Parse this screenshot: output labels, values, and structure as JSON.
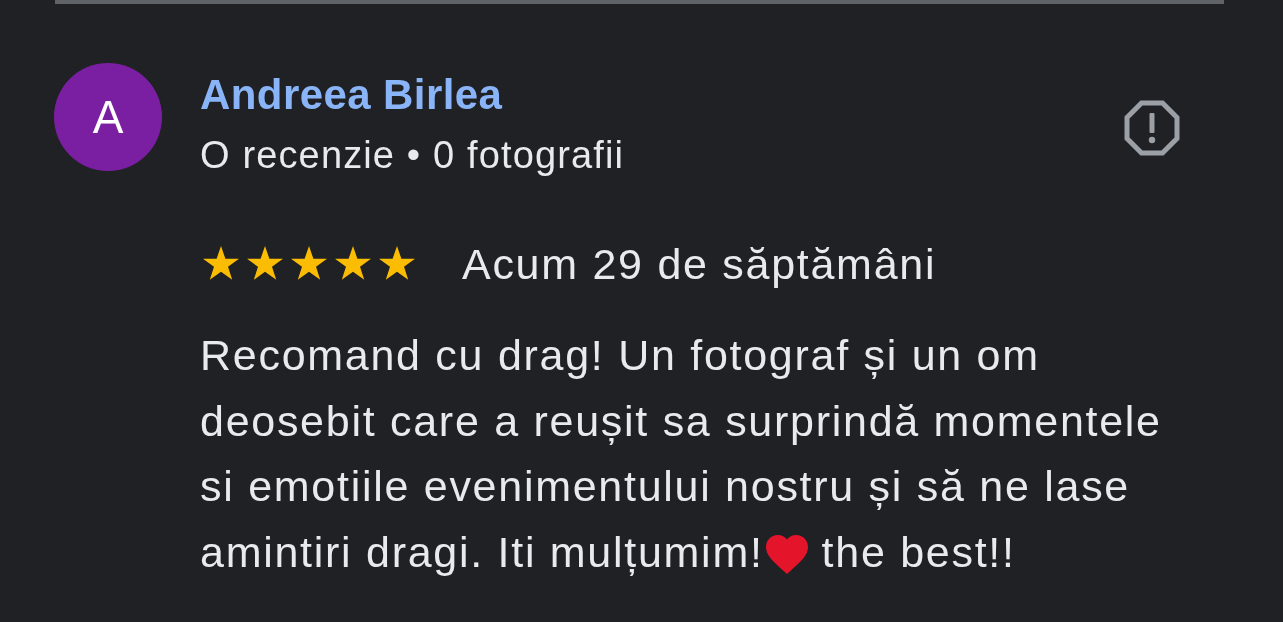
{
  "review": {
    "author": {
      "initial": "A",
      "name": "Andreea Birlea",
      "stats": "O recenzie • 0 fotografii"
    },
    "stars": 5,
    "date": "Acum 29 de săptămâni",
    "body": [
      {
        "kind": "text",
        "text": "Recomand cu drag! Un fotograf și un om deosebit care a reușit sa surprindă momentele si emotiile evenimentului nostru și să ne lase amintiri dragi. Iti mulțumim!"
      },
      {
        "kind": "heart"
      },
      {
        "kind": "text",
        "text": "the best!!"
      }
    ]
  }
}
